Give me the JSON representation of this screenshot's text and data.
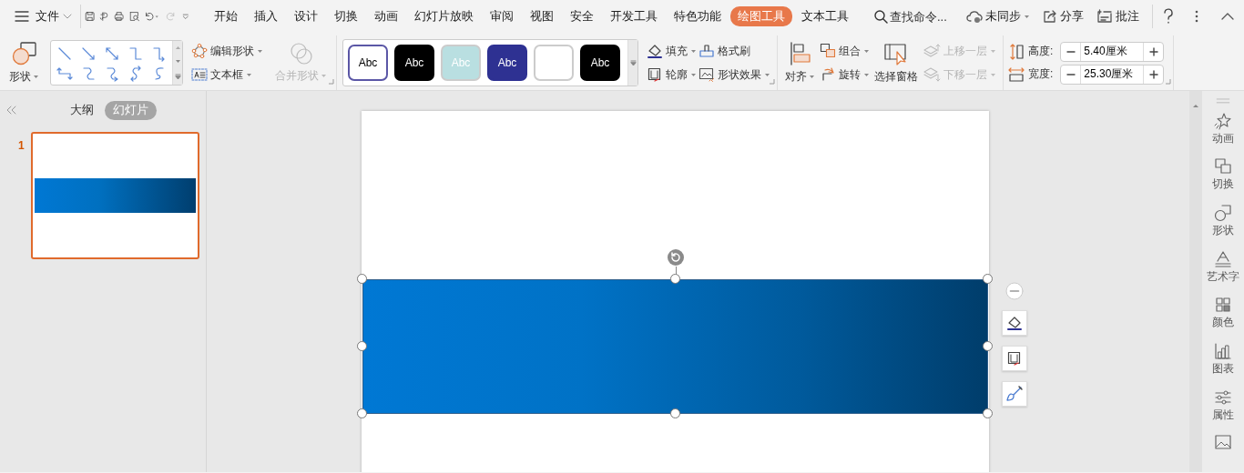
{
  "menu": {
    "file": "文件",
    "tabs": [
      {
        "label": "开始",
        "selected": false
      },
      {
        "label": "插入",
        "selected": false
      },
      {
        "label": "设计",
        "selected": false
      },
      {
        "label": "切换",
        "selected": false
      },
      {
        "label": "动画",
        "selected": false
      },
      {
        "label": "幻灯片放映",
        "selected": false
      },
      {
        "label": "审阅",
        "selected": false
      },
      {
        "label": "视图",
        "selected": false
      },
      {
        "label": "安全",
        "selected": false
      },
      {
        "label": "开发工具",
        "selected": false
      },
      {
        "label": "特色功能",
        "selected": false
      },
      {
        "label": "绘图工具",
        "selected": true
      },
      {
        "label": "文本工具",
        "selected": false
      }
    ],
    "search": {
      "placeholder": "查找命令..."
    },
    "actions": [
      {
        "kind": "sync",
        "label": "未同步",
        "dropdown": true
      },
      {
        "kind": "share",
        "label": "分享",
        "dropdown": false
      },
      {
        "kind": "comment",
        "label": "批注",
        "dropdown": false
      }
    ]
  },
  "ribbon": {
    "shape": {
      "label": "形状"
    },
    "edit": [
      {
        "kind": "edit-shape",
        "label": "编辑形状",
        "disabled": false
      },
      {
        "kind": "text-box",
        "label": "文本框",
        "disabled": false
      }
    ],
    "merge": {
      "label": "合并形状",
      "disabled": true
    },
    "styles": [
      {
        "label": "Abc",
        "color": "#ffffff",
        "selected": true
      },
      {
        "label": "Abc",
        "color": "#000000",
        "selected": false
      },
      {
        "label": "Abc",
        "color": "#b9dfe1",
        "selected": false
      },
      {
        "label": "Abc",
        "color": "#2e3192",
        "selected": false
      },
      {
        "color": "#ffffff",
        "selected": false
      },
      {
        "label": "Abc",
        "color": "#000000",
        "selected": false
      }
    ],
    "format": [
      {
        "kind": "fill",
        "label": "填充",
        "dropdown": true
      },
      {
        "kind": "painter",
        "label": "格式刷",
        "dropdown": false
      },
      {
        "kind": "outline",
        "label": "轮廓",
        "dropdown": true
      },
      {
        "kind": "effects",
        "label": "形状效果",
        "dropdown": true
      }
    ],
    "align": {
      "label": "对齐"
    },
    "group": [
      {
        "kind": "group",
        "label": "组合",
        "disabled": false
      },
      {
        "kind": "rotate",
        "label": "旋转",
        "disabled": false
      }
    ],
    "pane": {
      "label": "选择窗格"
    },
    "order": [
      {
        "kind": "up",
        "label": "上移一层",
        "disabled": true
      },
      {
        "kind": "down",
        "label": "下移一层",
        "disabled": true
      }
    ],
    "size": [
      {
        "kind": "height",
        "label": "高度:",
        "value": "5.40厘米"
      },
      {
        "kind": "width",
        "label": "宽度:",
        "value": "25.30厘米"
      }
    ]
  },
  "left_panel": {
    "tabs": [
      {
        "label": "大纲",
        "selected": false
      },
      {
        "label": "幻灯片",
        "selected": true
      }
    ],
    "slides": [
      {
        "number": "1",
        "selected": true
      }
    ]
  },
  "sidebar": {
    "items": [
      {
        "kind": "animation",
        "label": "动画"
      },
      {
        "kind": "transition",
        "label": "切换"
      },
      {
        "kind": "shape",
        "label": "形状"
      },
      {
        "kind": "art-text",
        "label": "艺术字"
      },
      {
        "kind": "color",
        "label": "颜色"
      },
      {
        "kind": "chart",
        "label": "图表"
      },
      {
        "kind": "properties",
        "label": "属性"
      },
      {
        "kind": "image"
      }
    ]
  }
}
